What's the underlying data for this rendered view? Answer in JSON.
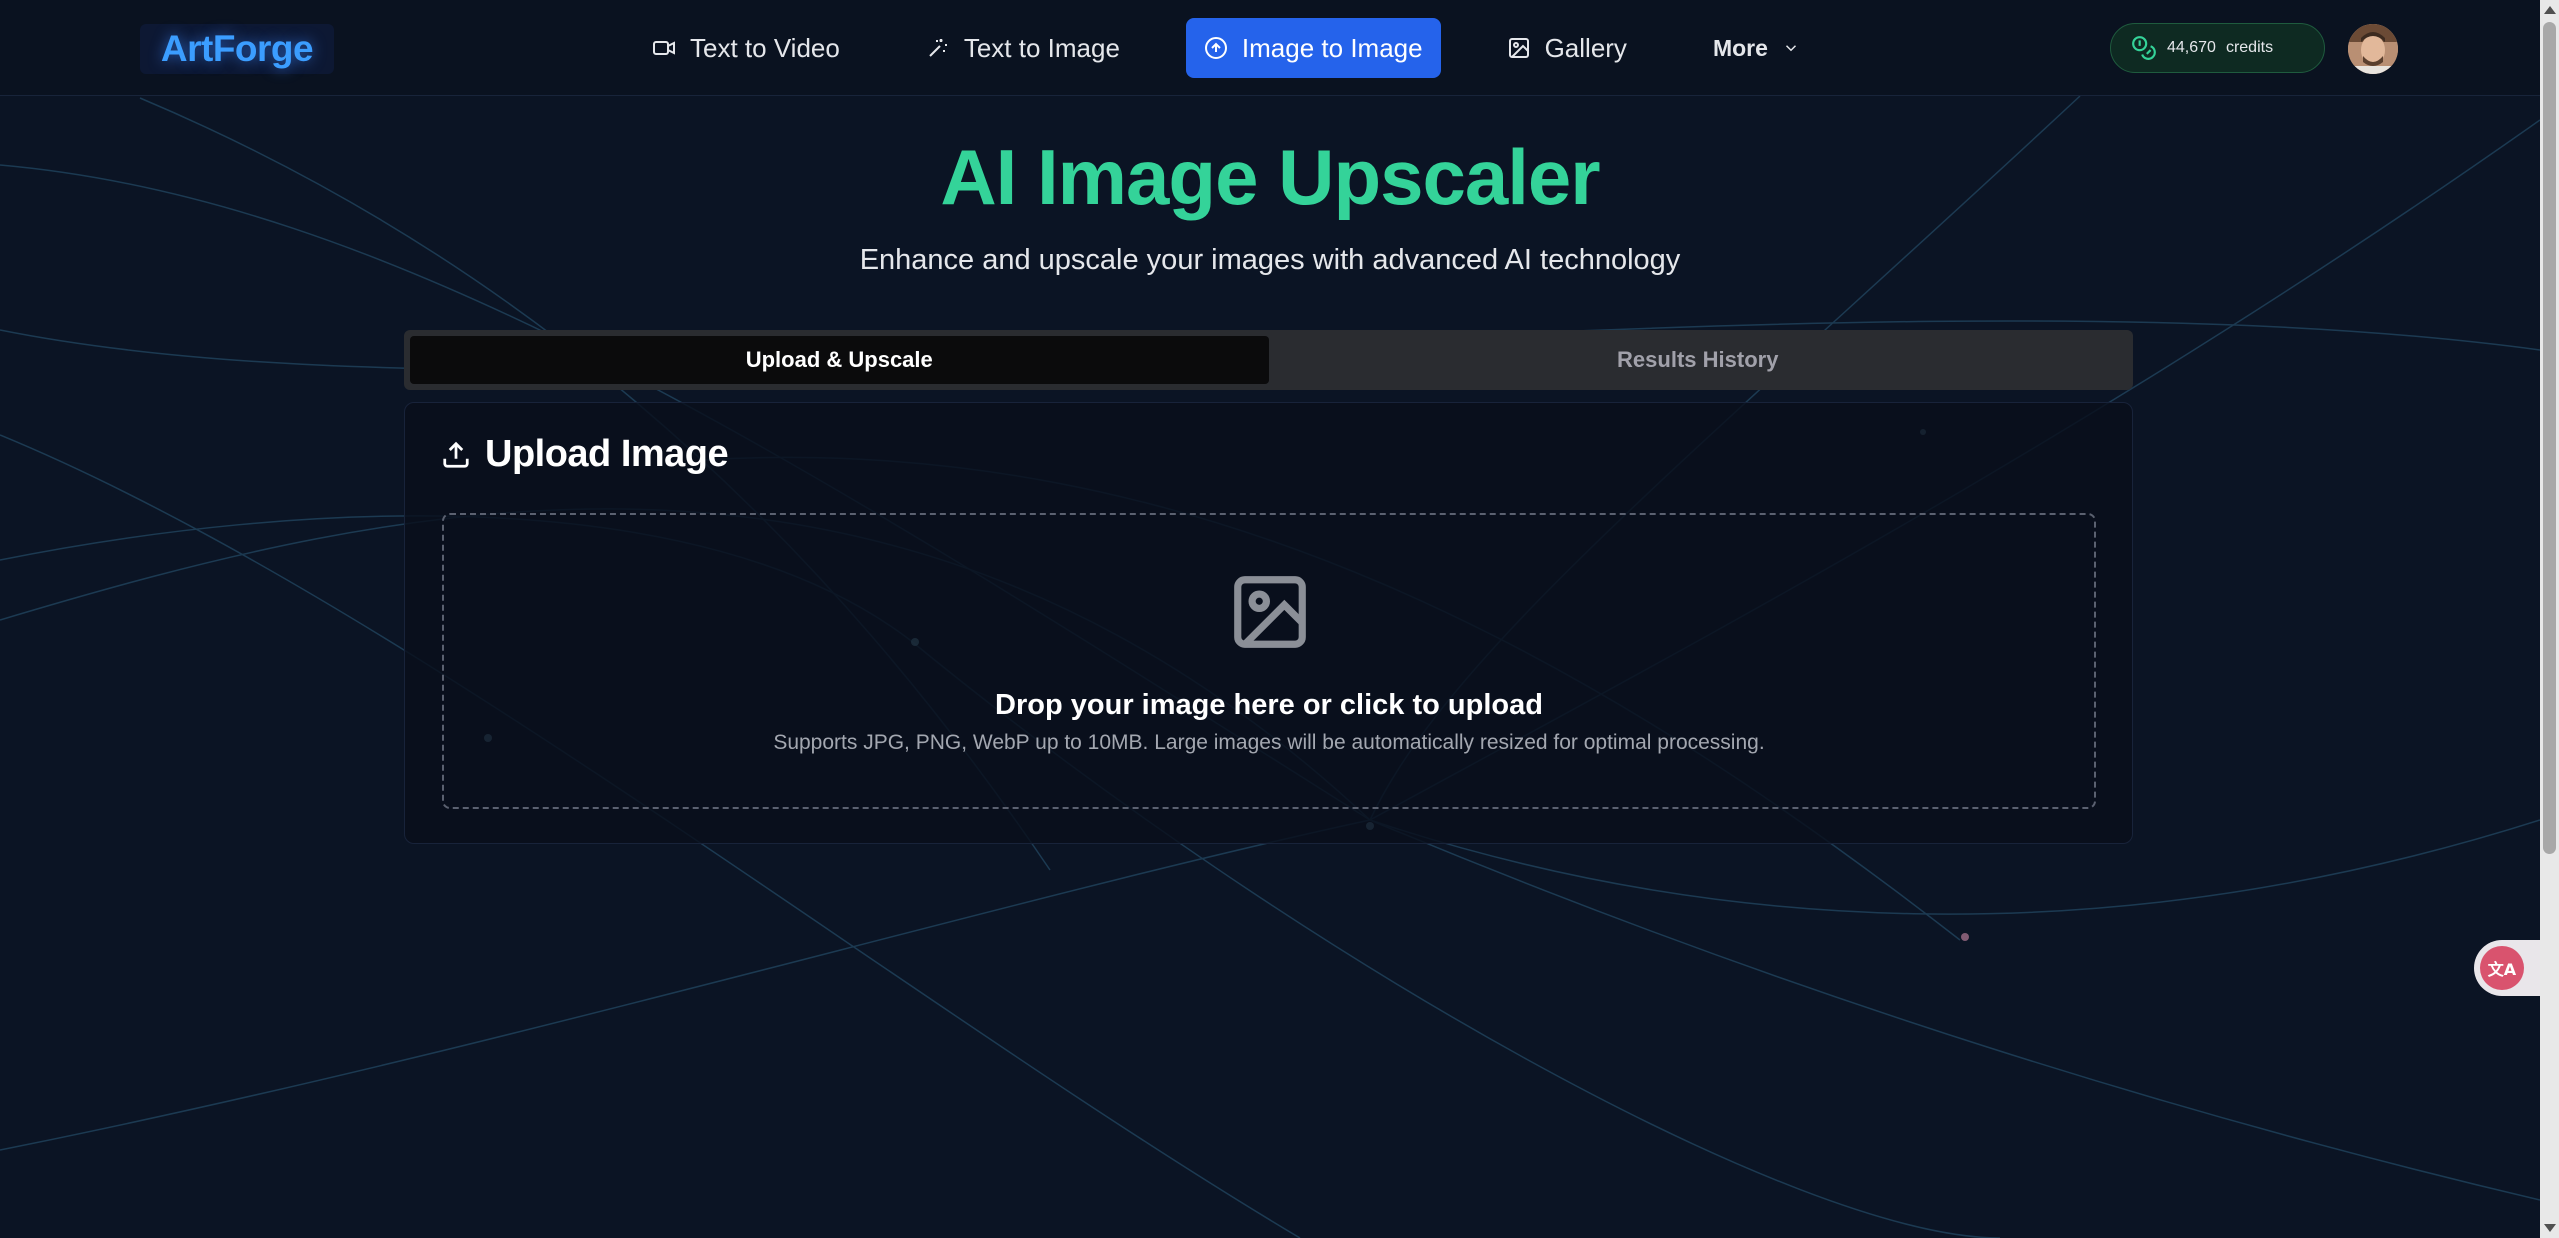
{
  "brand": {
    "logo": "ArtForge"
  },
  "nav": {
    "items": [
      {
        "label": "Text to Video",
        "icon": "video-icon"
      },
      {
        "label": "Text to Image",
        "icon": "sparkles-icon"
      },
      {
        "label": "Image to Image",
        "icon": "upload-circle-icon",
        "active": true
      },
      {
        "label": "Gallery",
        "icon": "image-icon"
      },
      {
        "label": "More",
        "icon": "chevron-down-icon"
      }
    ]
  },
  "credits": {
    "amount": "44,670",
    "label": "credits",
    "icon": "coins-icon"
  },
  "hero": {
    "title": "AI Image Upscaler",
    "subtitle": "Enhance and upscale your images with advanced AI technology"
  },
  "tabs": [
    {
      "label": "Upload & Upscale",
      "active": true
    },
    {
      "label": "Results History",
      "active": false
    }
  ],
  "upload_card": {
    "title": "Upload Image",
    "dropzone_title": "Drop your image here or click to upload",
    "dropzone_subtitle": "Supports JPG, PNG, WebP up to 10MB. Large images will be automatically resized for optimal processing."
  },
  "translate_widget": {
    "glyph": "文A"
  },
  "colors": {
    "background": "#0b1424",
    "accent_green": "#34d399",
    "accent_blue": "#2563eb",
    "logo_blue": "#3b9dff"
  }
}
